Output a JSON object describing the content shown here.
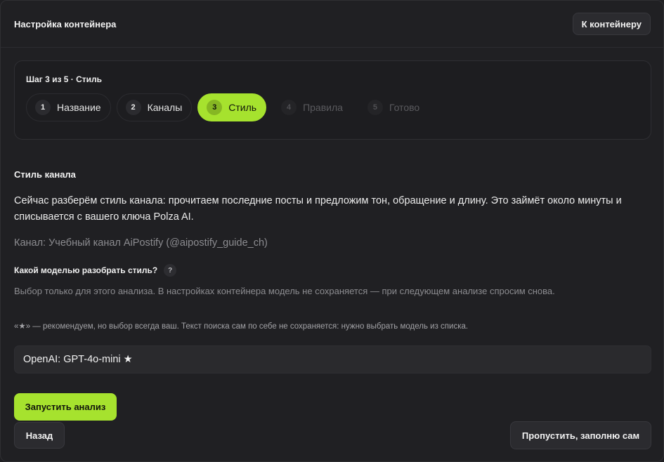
{
  "header": {
    "title": "Настройка контейнера",
    "to_container_label": "К контейнеру"
  },
  "stepper": {
    "caption": "Шаг 3 из 5 · Стиль",
    "steps": [
      {
        "num": "1",
        "label": "Название",
        "state": "done"
      },
      {
        "num": "2",
        "label": "Каналы",
        "state": "done"
      },
      {
        "num": "3",
        "label": "Стиль",
        "state": "active"
      },
      {
        "num": "4",
        "label": "Правила",
        "state": "disabled"
      },
      {
        "num": "5",
        "label": "Готово",
        "state": "disabled"
      }
    ]
  },
  "content": {
    "section_title": "Стиль канала",
    "description": "Сейчас разберём стиль канала: прочитаем последние посты и предложим тон, обращение и длину. Это займёт около минуты и списывается с вашего ключа Polza AI.",
    "channel": "Канал: Учебный канал AiPostify (@aipostify_guide_ch)",
    "question": "Какой моделью разобрать стиль?",
    "help_glyph": "?",
    "hint_model": "Выбор только для этого анализа. В настройках контейнера модель не сохраняется — при следующем анализе спросим снова.",
    "hint_star": "«★» — рекомендуем, но выбор всегда ваш. Текст поиска сам по себе не сохраняется: нужно выбрать модель из списка.",
    "selected_model": "OpenAI: GPT-4o-mini ★"
  },
  "actions": {
    "run_label": "Запустить анализ",
    "back_label": "Назад",
    "skip_label": "Пропустить, заполню сам"
  },
  "colors": {
    "accent": "#a6e22e",
    "background": "#202023"
  }
}
